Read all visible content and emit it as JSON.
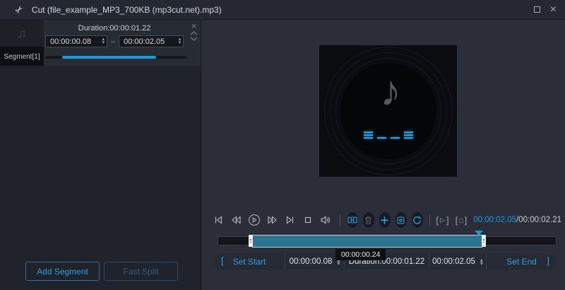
{
  "window": {
    "title": "Cut (file_example_MP3_700KB (mp3cut.net).mp3)"
  },
  "colors": {
    "accent": "#2196d4",
    "timeline_selection_fill": "#2a7391",
    "left_panel_bg": "#20232b",
    "right_panel_bg": "#2b2e39"
  },
  "icons": {
    "scissors": "✂",
    "thumb_note": "♫",
    "artwork_note": "♪",
    "close": "×",
    "card_close": "×",
    "dash": "–",
    "spin_up": "▴",
    "spin_down": "▾",
    "bracket_open": "[",
    "bracket_close": "]",
    "play_glyph": "▷",
    "stop_glyph": "□"
  },
  "segment_panel": {
    "item_label": "Segment[1]",
    "duration_label": "Duration:00:00:01.22",
    "start_value": "00:00:00.08",
    "end_value": "00:00:02.05",
    "progress_style": "left:12%;width:66.5%",
    "add_segment_label": "Add Segment",
    "fast_split_label": "Fast Split"
  },
  "player": {
    "current_time": "00:00:02.05",
    "time_separator": "/",
    "total_time": "00:00:02.21"
  },
  "timeline": {
    "selection_style": "left:48px;width:326px",
    "playhead_style": "left:363px",
    "tooltip": "00:00:00.24"
  },
  "trimbar": {
    "bracket_open": "[",
    "set_start_label": "Set Start",
    "start_value": "00:00:00.08",
    "duration_label": "Duration:00:00:01.22",
    "end_value": "00:00:02.05",
    "set_end_label": "Set End",
    "bracket_close": "]"
  }
}
